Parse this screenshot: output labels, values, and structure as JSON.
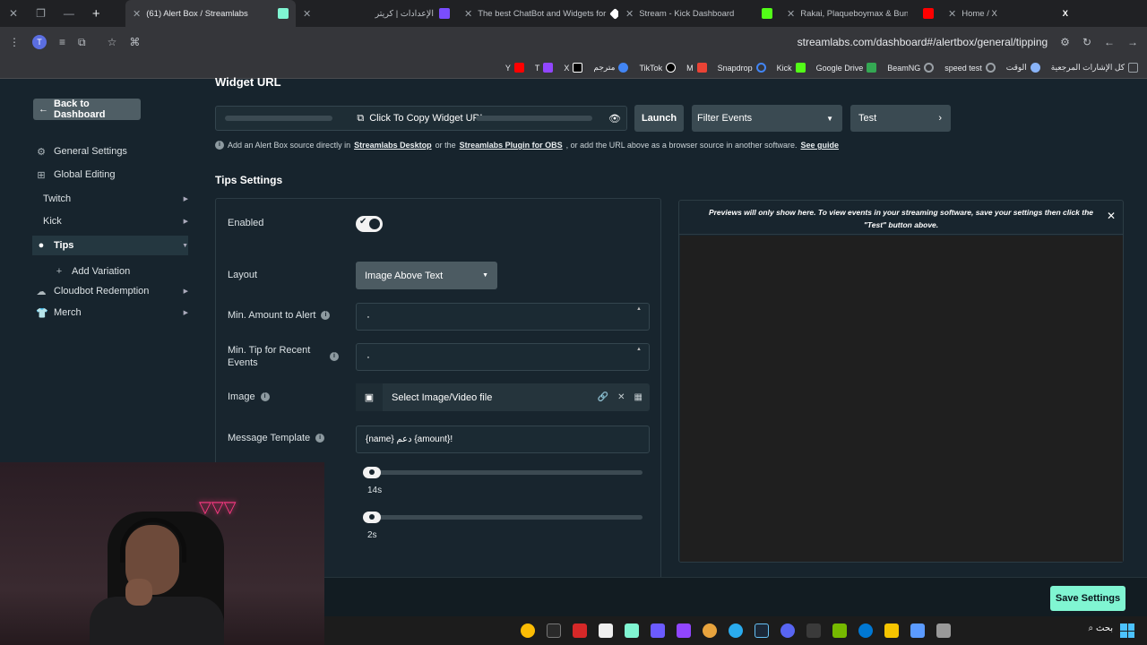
{
  "browser": {
    "tabs": [
      {
        "title": "(61) Alert Box / Streamlabs",
        "active": true,
        "color": "#80f5d2"
      },
      {
        "title": "الإعدادات | كريتر",
        "active": false,
        "color": "#7a4dff"
      },
      {
        "title": "The best ChatBot and Widgets for",
        "active": false,
        "color": "#ffffff"
      },
      {
        "title": "Stream - Kick Dashboard",
        "active": false,
        "color": "#53fc18"
      },
      {
        "title": "Rakai, Plaqueboymax & Bunnu",
        "active": false,
        "color": "#ff0000"
      },
      {
        "title": "Home / X",
        "active": false,
        "color": "#ffffff"
      }
    ],
    "url": "streamlabs.com/dashboard#/alertbox/general/tipping",
    "bookmarks": [
      {
        "label": "كل الإشارات المرجعية",
        "color": "#9aa0a6"
      },
      {
        "label": "الوقت",
        "color": "#8ab4f8"
      },
      {
        "label": "speed test",
        "color": "#9aa0a6"
      },
      {
        "label": "BeamNG",
        "color": "#9aa0a6"
      },
      {
        "label": "Google Drive",
        "color": "#34a853"
      },
      {
        "label": "Kick",
        "color": "#53fc18"
      },
      {
        "label": "Snapdrop",
        "color": "#4285f4"
      },
      {
        "label": "M",
        "color": "#ea4335"
      },
      {
        "label": "TikTok",
        "color": "#ffffff"
      },
      {
        "label": "مترجم",
        "color": "#4285f4"
      },
      {
        "label": "X",
        "color": "#ffffff"
      },
      {
        "label": "T",
        "color": "#9146ff"
      },
      {
        "label": "Y",
        "color": "#ff0000"
      }
    ]
  },
  "sidebar": {
    "back_label": "Back to Dashboard",
    "items": [
      {
        "label": "General Settings",
        "icon": "gear-icon",
        "has_chevron": false,
        "active": false
      },
      {
        "label": "Global Editing",
        "icon": "grid-icon",
        "has_chevron": false,
        "active": false
      },
      {
        "label": "Twitch",
        "icon": "",
        "has_chevron": true,
        "active": false
      },
      {
        "label": "Kick",
        "icon": "",
        "has_chevron": true,
        "active": false
      },
      {
        "label": "Tips",
        "icon": "coins-icon",
        "has_chevron": true,
        "active": true
      },
      {
        "label": "Add Variation",
        "icon": "plus-icon",
        "has_chevron": false,
        "active": false
      },
      {
        "label": "Cloudbot Redemption",
        "icon": "cloudbot-icon",
        "has_chevron": true,
        "active": false
      },
      {
        "label": "Merch",
        "icon": "shirt-icon",
        "has_chevron": true,
        "active": false
      }
    ]
  },
  "widget": {
    "title": "Widget URL",
    "copy_label": "Click To Copy Widget URL",
    "launch_label": "Launch",
    "filter_label": "Filter Events",
    "test_label": "Test",
    "info_prefix": "Add an Alert Box source directly in",
    "info_link1": "Streamlabs Desktop",
    "info_mid": "or the",
    "info_link2": "Streamlabs Plugin for OBS",
    "info_suffix": ", or add the URL above as a browser source in another software.",
    "info_link3": "See guide"
  },
  "tips": {
    "heading": "Tips Settings",
    "enabled_label": "Enabled",
    "enabled_value": true,
    "layout_label": "Layout",
    "layout_value": "Image Above Text",
    "min_amount_label": "Min. Amount to Alert",
    "min_amount_value": "٠",
    "min_recent_label": "Min. Tip for Recent Events",
    "min_recent_value": "٠",
    "image_label": "Image",
    "image_value": "Select Image/Video file",
    "message_label": "Message Template",
    "message_value": "{name} دعم {amount}!",
    "slider1_value": "14s",
    "slider2_value": "2s"
  },
  "preview": {
    "note": "Previews will only show here. To view events in your streaming software, save your settings then click the \"Test\" button above."
  },
  "footer": {
    "save_label": "Save Settings"
  },
  "taskbar": {
    "search_label": "بحث"
  },
  "colors": {
    "accent": "#80f5d2",
    "bg": "#17242d"
  }
}
